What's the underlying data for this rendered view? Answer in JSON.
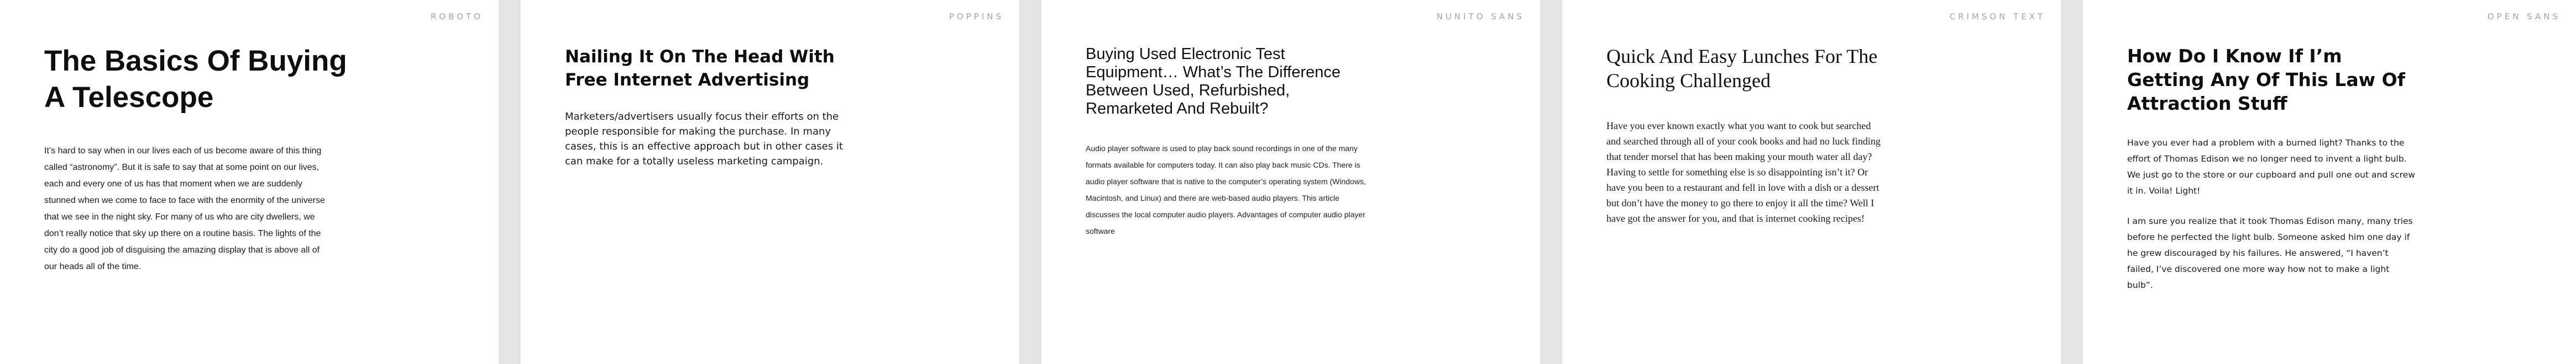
{
  "cards": [
    {
      "font_label": "ROBOTO",
      "title": "The Basics Of Buying A Telescope",
      "paragraphs": [
        "It’s hard to say when in our lives each of us become aware of this thing called “astronomy”. But it is safe to say that at some point on our lives, each and every one of us has that moment when we are suddenly stunned when we come to face to face with the enormity of the universe that we see in the night sky. For many of us who are city dwellers, we don’t really notice that sky up there on a routine basis. The lights of the city do a good job of disguising the amazing display that is above all of our heads all of the time."
      ]
    },
    {
      "font_label": "POPPINS",
      "title": "Nailing It On The Head With Free Internet Advertising",
      "paragraphs": [
        "Marketers/advertisers usually focus their efforts on the people responsible for making the purchase. In many cases, this is an effective approach but in other cases it can make for a totally useless marketing campaign."
      ]
    },
    {
      "font_label": "NUNITO SANS",
      "title": "Buying Used Electronic Test Equipment… What’s The Difference Between Used, Refurbished, Remarketed And Rebuilt?",
      "paragraphs": [
        "Audio player software is used to play back sound recordings in one of the many formats available for computers today. It can also play back music CDs. There is audio player software that is native to the computer’s operating system (Windows, Macintosh, and Linux) and there are web-based audio players. This article discusses the local computer audio players. Advantages of computer audio player software"
      ]
    },
    {
      "font_label": "CRIMSON TEXT",
      "title": "Quick And Easy Lunches For The Cooking Challenged",
      "paragraphs": [
        "Have you ever known exactly what you want to cook but searched and searched through all of your cook books and had no luck finding that tender morsel that has been making your mouth water all day? Having to settle for something else is so disappointing isn’t it? Or have you been to a restaurant and fell in love with a dish or a dessert but don’t have the money to go there to enjoy it all the time? Well I have got the answer for you, and that is internet cooking recipes!"
      ]
    },
    {
      "font_label": "OPEN SANS",
      "title": "How Do I Know If I’m Getting Any Of This Law Of Attraction Stuff",
      "paragraphs": [
        "Have you ever had a problem with a burned light? Thanks to the effort of Thomas Edison we no longer need to invent a light bulb. We just go to the store or our cupboard and pull one out and screw it in. Voila! Light!",
        "I am sure you realize that it took Thomas Edison many, many tries before he perfected the light bulb. Someone asked him one day if he grew discouraged by his failures. He answered, “I haven’t failed, I’ve discovered one more way how not to make a light bulb”."
      ]
    }
  ]
}
